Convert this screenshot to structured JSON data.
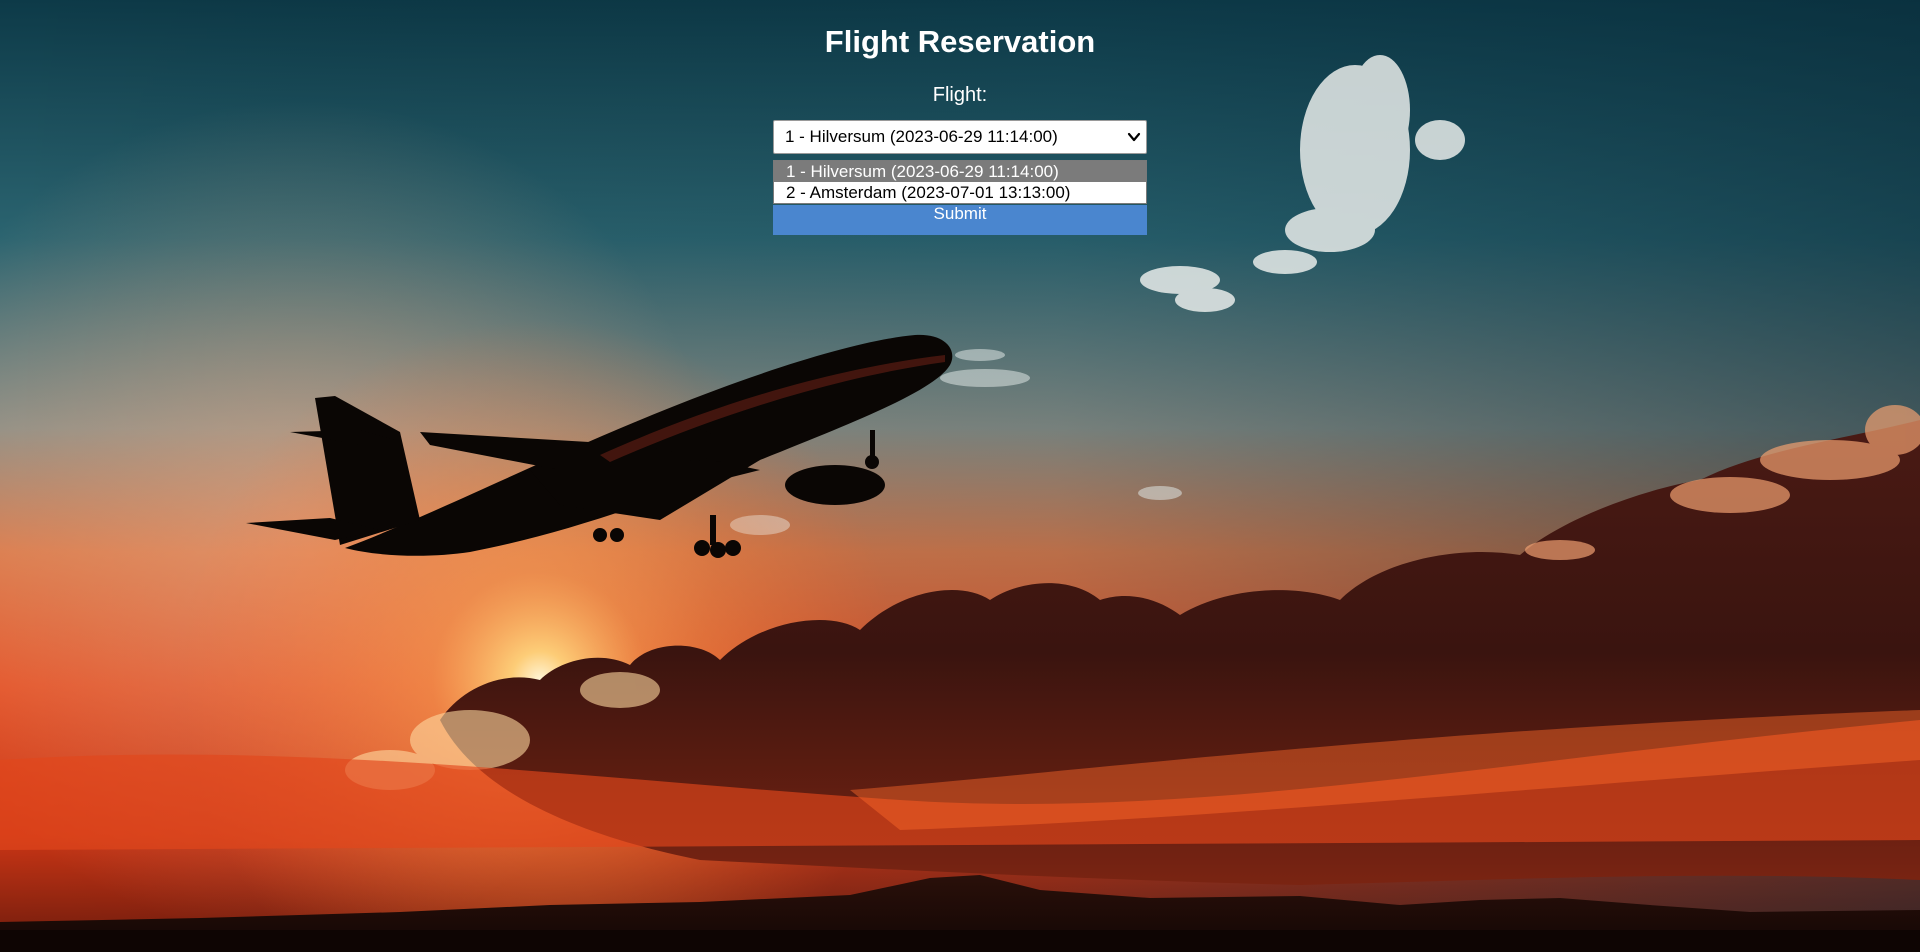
{
  "page": {
    "title": "Flight Reservation"
  },
  "form": {
    "flight_label": "Flight:",
    "flight_select": {
      "selected_value": "1 - Hilversum (2023-06-29 11:14:00)",
      "options": [
        "1 - Hilversum (2023-06-29 11:14:00)",
        "2 - Amsterdam (2023-07-01 13:13:00)"
      ],
      "highlighted_index": 0
    },
    "submit_label": "Submit"
  },
  "icons": {
    "select_arrow": "chevron-down-icon"
  },
  "colors": {
    "submit_background": "#4a86cf",
    "option_highlight": "#7b7b7b",
    "text_on_background": "#ffffff"
  }
}
